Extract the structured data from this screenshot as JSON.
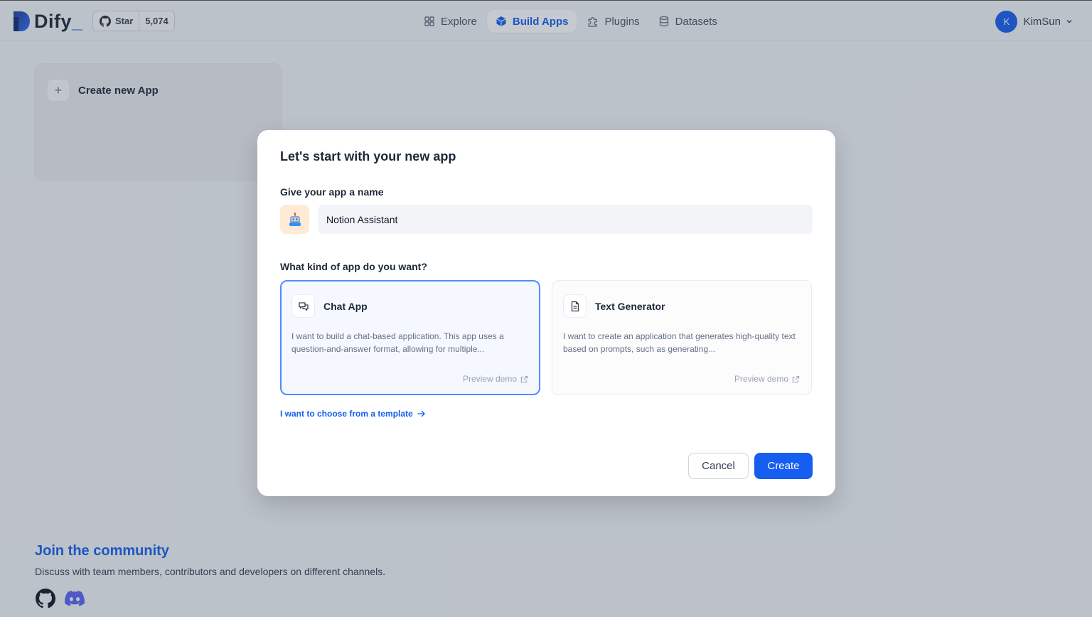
{
  "header": {
    "logo_text": "Dify",
    "logo_suffix": "_",
    "github": {
      "star_label": "Star",
      "star_count": "5,074"
    },
    "nav": [
      {
        "label": "Explore",
        "icon": "grid-icon"
      },
      {
        "label": "Build Apps",
        "icon": "cube-icon"
      },
      {
        "label": "Plugins",
        "icon": "puzzle-icon"
      },
      {
        "label": "Datasets",
        "icon": "database-icon"
      }
    ],
    "active_nav": "Build Apps",
    "user": {
      "avatar_initial": "K",
      "name": "KimSun"
    }
  },
  "background": {
    "create_card_label": "Create new App",
    "community": {
      "title": "Join the community",
      "subtitle": "Discuss with team members, contributors and developers on different channels."
    }
  },
  "modal": {
    "title": "Let's start with your new app",
    "name_label": "Give your app a name",
    "app_icon": "robot-emoji",
    "app_name_value": "Notion Assistant",
    "kind_label": "What kind of app do you want?",
    "types": [
      {
        "name": "Chat App",
        "icon": "chat-bubbles-icon",
        "description": "I want to build a chat-based application. This app uses a question-and-answer format, allowing for multiple...",
        "preview_label": "Preview demo",
        "selected": true
      },
      {
        "name": "Text Generator",
        "icon": "document-icon",
        "description": "I want to create an application that generates high-quality text based on prompts, such as generating...",
        "preview_label": "Preview demo",
        "selected": false
      }
    ],
    "template_link": "I want to choose from a template",
    "cancel_label": "Cancel",
    "create_label": "Create"
  },
  "colors": {
    "primary": "#155eef",
    "selected_border": "#528bff",
    "emoji_bg": "#ffead5"
  }
}
